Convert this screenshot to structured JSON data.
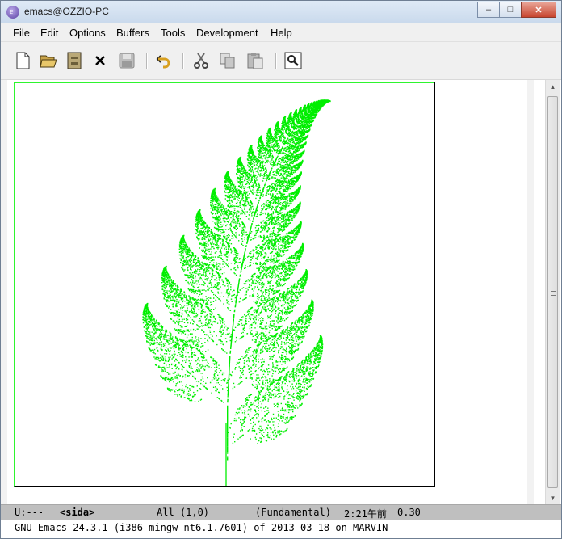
{
  "window": {
    "title": "emacs@OZZIO-PC",
    "buttons": {
      "minimize_icon": "minimize-icon",
      "maximize_icon": "maximize-icon",
      "close_icon": "close-icon"
    }
  },
  "menubar": {
    "items": [
      "File",
      "Edit",
      "Options",
      "Buffers",
      "Tools",
      "Development",
      "Help"
    ]
  },
  "toolbar": {
    "icons": [
      "new-file-icon",
      "open-folder-icon",
      "dired-icon",
      "close-buffer-icon",
      "save-icon",
      "undo-icon",
      "cut-icon",
      "copy-icon",
      "paste-icon",
      "search-icon"
    ]
  },
  "buffer": {
    "image_content": "fern-fractal",
    "fern_color": "#00ee00"
  },
  "modeline": {
    "status": "U:---",
    "buffer_name": "<sida>",
    "position": "All (1,0)",
    "mode": "(Fundamental)",
    "time": "2:21午前",
    "load": "0.30"
  },
  "echo_area": {
    "message": "GNU Emacs 24.3.1 (i386-mingw-nt6.1.7601) of 2013-03-18 on MARVIN"
  }
}
